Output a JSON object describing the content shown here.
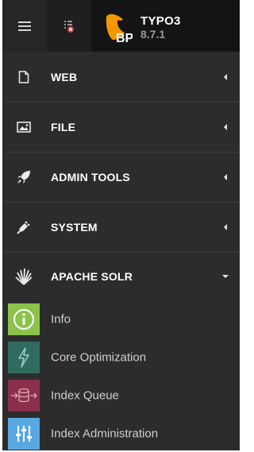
{
  "topbar": {
    "menu_icon": "hamburger-icon",
    "clear_cache_icon": "clear-cache-icon",
    "logo": {
      "name": "TYPO3",
      "version": "8.7.1",
      "badge": "BP",
      "accent": "#f49700"
    }
  },
  "groups": [
    {
      "label": "WEB",
      "icon": "page-icon",
      "state": "collapsed"
    },
    {
      "label": "FILE",
      "icon": "image-icon",
      "state": "collapsed"
    },
    {
      "label": "ADMIN TOOLS",
      "icon": "rocket-icon",
      "state": "collapsed"
    },
    {
      "label": "SYSTEM",
      "icon": "plug-icon",
      "state": "collapsed"
    },
    {
      "label": "APACHE SOLR",
      "icon": "solr-icon",
      "state": "expanded"
    }
  ],
  "solr_modules": [
    {
      "label": "Info",
      "icon": "info-icon",
      "color": "#8cc34b"
    },
    {
      "label": "Core Optimization",
      "icon": "lightning-icon",
      "color": "#2f6b5e"
    },
    {
      "label": "Index Queue",
      "icon": "index-queue-icon",
      "color": "#8b2f4a"
    },
    {
      "label": "Index Administration",
      "icon": "sliders-icon",
      "color": "#5aa8e2"
    }
  ]
}
